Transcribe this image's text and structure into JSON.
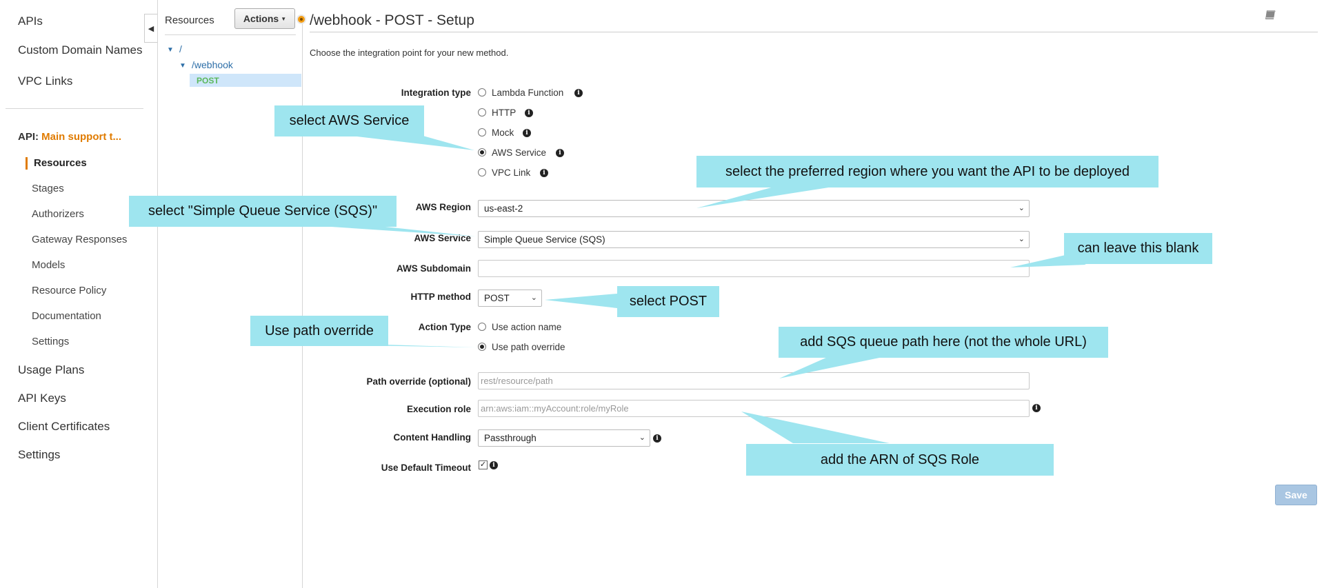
{
  "left_nav": {
    "apis": "APIs",
    "custom_domain_names": "Custom Domain Names",
    "vpc_links": "VPC Links",
    "api_prefix": "API:",
    "api_name": "Main support t...",
    "sub_items": [
      "Resources",
      "Stages",
      "Authorizers",
      "Gateway Responses",
      "Models",
      "Resource Policy",
      "Documentation",
      "Settings"
    ],
    "usage_plans": "Usage Plans",
    "api_keys": "API Keys",
    "client_certificates": "Client Certificates",
    "settings": "Settings"
  },
  "resources_panel": {
    "title": "Resources",
    "actions_label": "Actions",
    "tree": {
      "root": "/",
      "webhook": "/webhook",
      "method": "POST"
    }
  },
  "main": {
    "title": "/webhook - POST - Setup",
    "intro": "Choose the integration point for your new method.",
    "integration_type": {
      "label": "Integration type",
      "options": [
        "Lambda Function",
        "HTTP",
        "Mock",
        "AWS Service",
        "VPC Link"
      ],
      "selected": "AWS Service"
    },
    "aws_region": {
      "label": "AWS Region",
      "value": "us-east-2"
    },
    "aws_service": {
      "label": "AWS Service",
      "value": "Simple Queue Service (SQS)"
    },
    "aws_subdomain": {
      "label": "AWS Subdomain",
      "value": ""
    },
    "http_method": {
      "label": "HTTP method",
      "value": "POST"
    },
    "action_type": {
      "label": "Action Type",
      "options": [
        "Use action name",
        "Use path override"
      ],
      "selected": "Use path override"
    },
    "path_override": {
      "label": "Path override (optional)",
      "placeholder": "rest/resource/path"
    },
    "execution_role": {
      "label": "Execution role",
      "placeholder": "arn:aws:iam::myAccount:role/myRole"
    },
    "content_handling": {
      "label": "Content Handling",
      "value": "Passthrough"
    },
    "default_timeout": {
      "label": "Use Default Timeout",
      "checked": true
    },
    "save_label": "Save"
  },
  "callouts": {
    "aws_service": "select AWS Service",
    "region": "select the preferred region where you want the API to be deployed",
    "sqs": "select \"Simple Queue Service (SQS)\"",
    "blank": "can leave this blank",
    "post": "select POST",
    "path_override": "Use path override",
    "queue_path": "add SQS queue path here (not the whole URL)",
    "arn": "add the ARN of SQS Role"
  },
  "colors": {
    "accent_orange": "#e07b00",
    "callout_bg": "#9ee5ef",
    "link_blue": "#2e6fa8",
    "method_green": "#5cb85c"
  },
  "icons": [
    "book-icon",
    "info-icon",
    "collapse-arrow-icon",
    "tree-expand-icon",
    "chevron-down-icon"
  ]
}
